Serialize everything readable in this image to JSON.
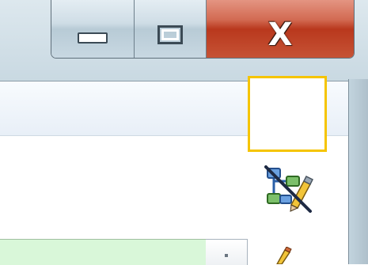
{
  "window": {
    "caption_buttons": {
      "minimize_icon": "minimize-icon",
      "maximize_icon": "maximize-icon",
      "close_glyph": "X"
    }
  },
  "toolbar": {
    "highlighted_tool_icon": "diagram-edit-icon",
    "highlight_color": "#f5c400"
  },
  "bottom_bar": {
    "field_color": "#d9f7d9",
    "edit_icon": "pencil-icon"
  }
}
